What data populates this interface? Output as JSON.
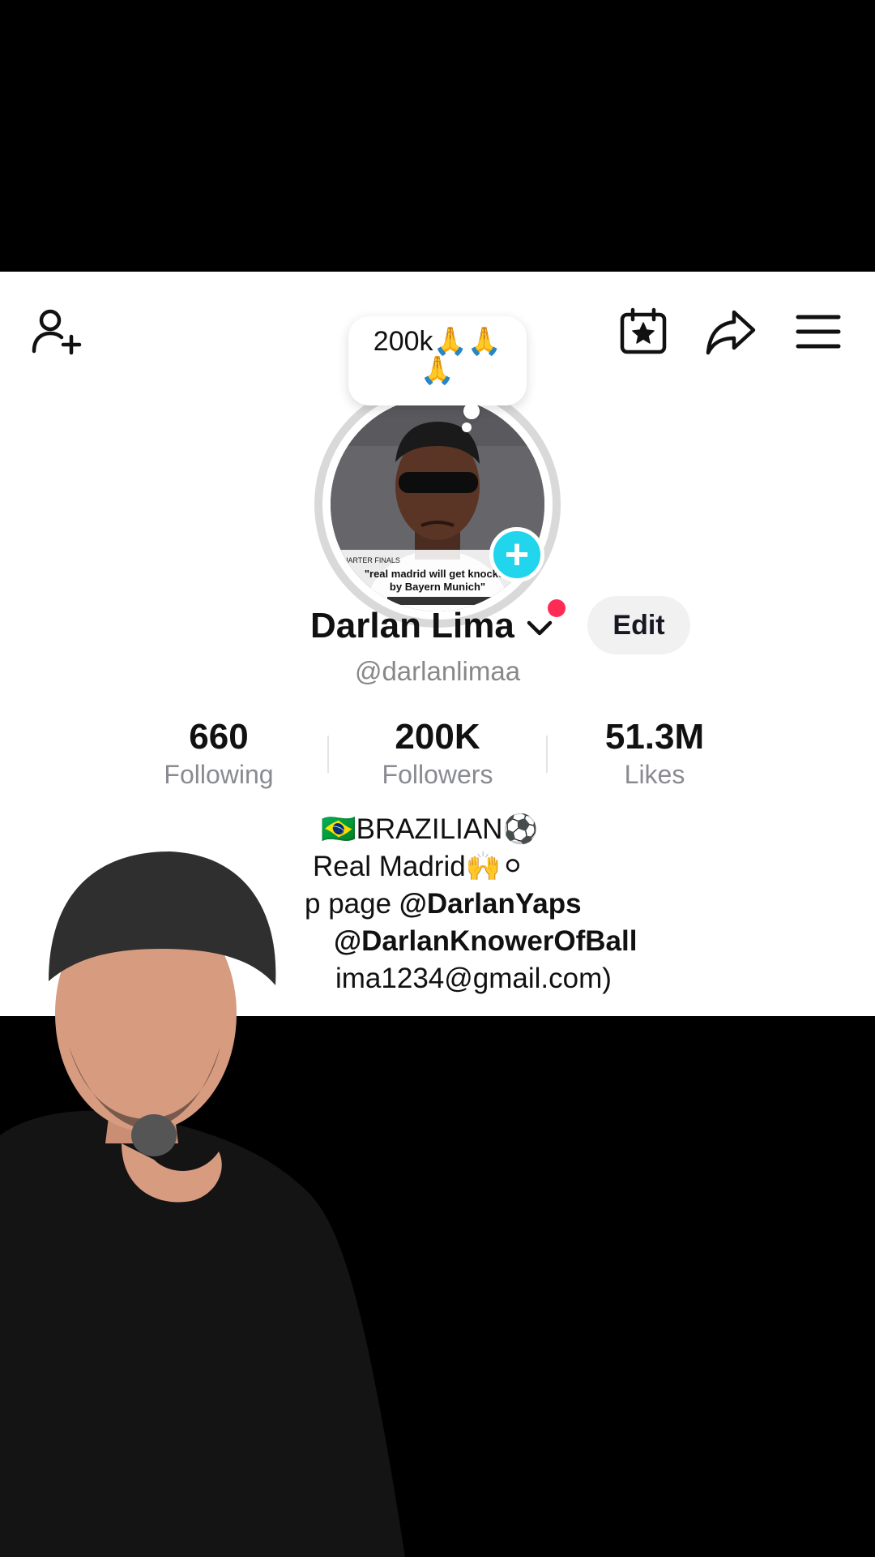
{
  "note": {
    "text": "200k🙏🙏🙏"
  },
  "profile": {
    "display_name": "Darlan Lima",
    "username": "@darlanlimaa",
    "edit_label": "Edit"
  },
  "stats": [
    {
      "value": "660",
      "label": "Following"
    },
    {
      "value": "200K",
      "label": "Followers"
    },
    {
      "value": "51.3M",
      "label": "Likes"
    }
  ],
  "bio": {
    "line1": "🇧🇷BRAZILIAN⚽",
    "line2": "Real Madrid🙌⚪",
    "line3_prefix": "p page ",
    "line3_handle": "@DarlanYaps",
    "line4_handle": "@DarlanKnowerOfBall",
    "line5": "ima1234@gmail.com)"
  },
  "avatar": {
    "caption_tag": "QUARTER FINALS",
    "caption_line1": "\"real madrid will get knocked",
    "caption_line2": "by Bayern Munich\""
  },
  "icons": [
    "add-friend-icon",
    "calendar-star-icon",
    "share-icon",
    "menu-icon",
    "chevron-down-icon",
    "plus-icon"
  ],
  "colors": {
    "accent_cyan": "#20d5ec",
    "notification_red": "#fe2c55",
    "edit_bg": "#f1f1f2"
  }
}
